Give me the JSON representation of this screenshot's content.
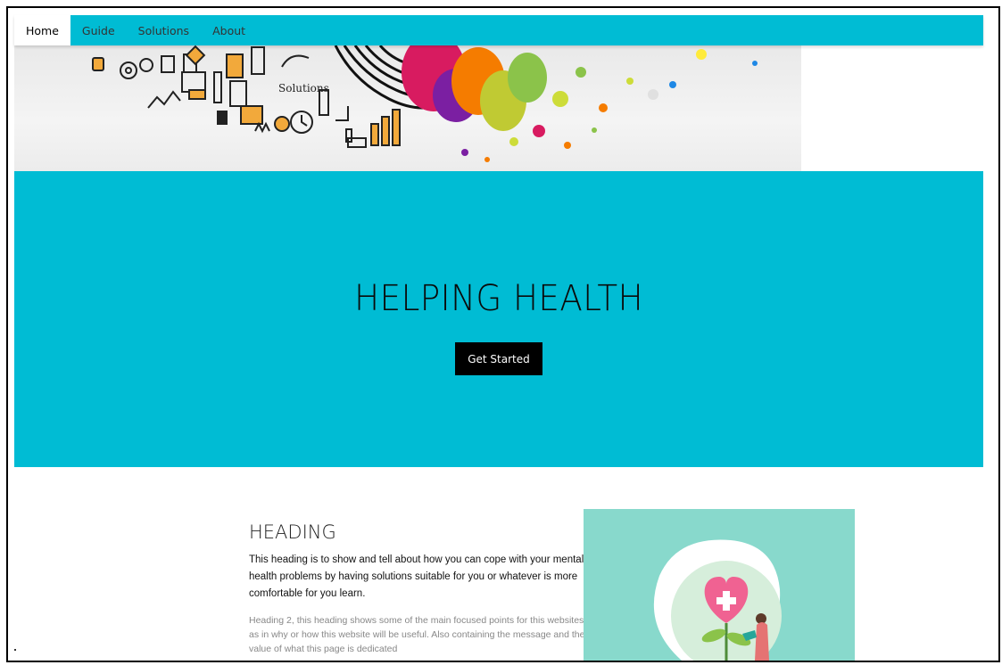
{
  "nav": {
    "items": [
      {
        "label": "Home",
        "active": true
      },
      {
        "label": "Guide",
        "active": false
      },
      {
        "label": "Solutions",
        "active": false
      },
      {
        "label": "About",
        "active": false
      }
    ]
  },
  "hero_image": {
    "doodle_word": "Solutions"
  },
  "banner": {
    "title": "HELPING HEALTH",
    "button_label": "Get Started"
  },
  "content": {
    "heading": "HEADING",
    "paragraph1": "This heading is to show and tell about how you can cope with your mental health problems by having solutions suitable for you or whatever is more comfortable for you learn.",
    "paragraph2": "Heading 2, this heading shows some of the main focused points for this websites as in why or how this website will be useful. Also containing the message and the value of what this page is dedicated"
  },
  "colors": {
    "accent": "#00bcd4",
    "illustration_bg": "#88d9cc"
  }
}
